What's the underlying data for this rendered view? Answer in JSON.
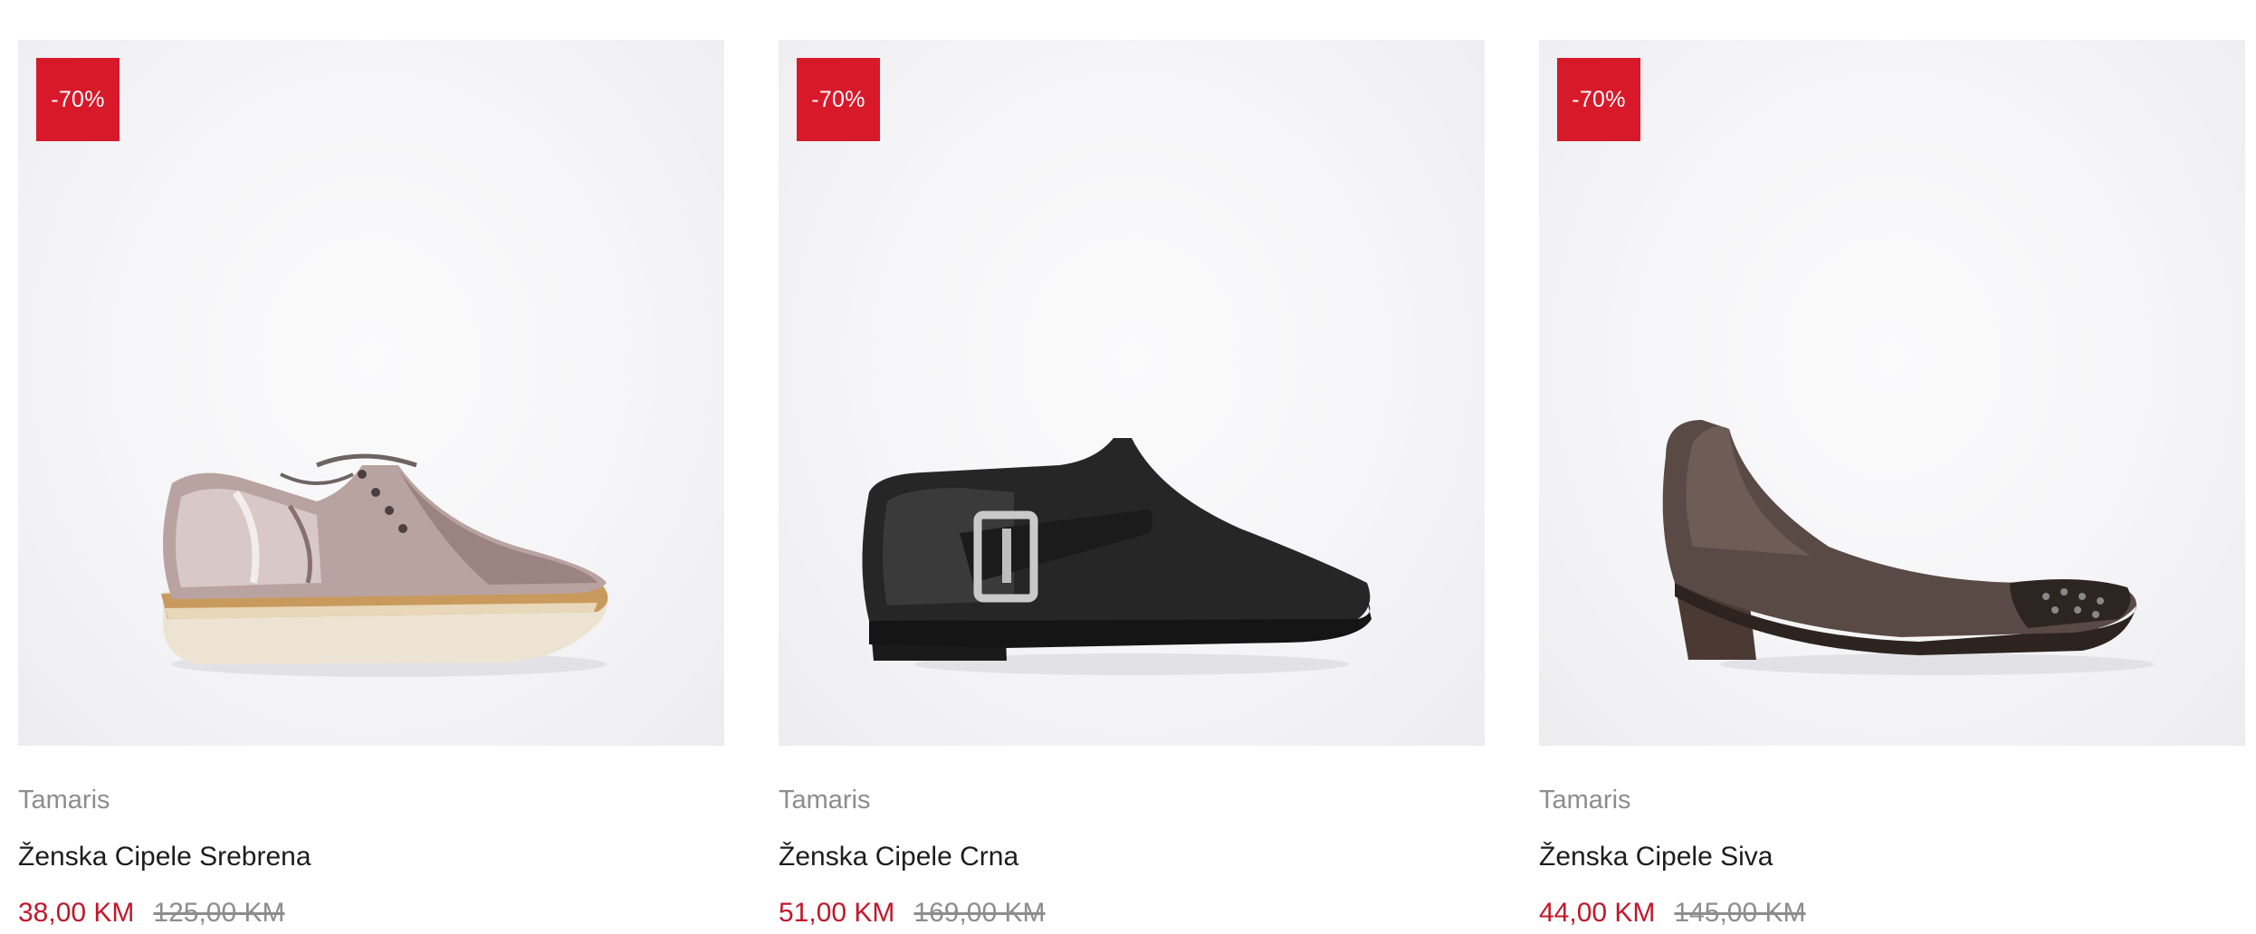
{
  "colors": {
    "badge_bg": "#d8192a",
    "sale_price": "#c0182b",
    "muted_text": "#8d8d8d",
    "image_bg": "#f4f4f6"
  },
  "products": [
    {
      "badge": "-70%",
      "brand": "Tamaris",
      "title": "Ženska Cipele Srebrena",
      "price": "38,00 KM",
      "old_price": "125,00 KM",
      "image": "metallic-lace-up-shoe"
    },
    {
      "badge": "-70%",
      "brand": "Tamaris",
      "title": "Ženska Cipele Crna",
      "price": "51,00 KM",
      "old_price": "169,00 KM",
      "image": "black-buckle-loafer"
    },
    {
      "badge": "-70%",
      "brand": "Tamaris",
      "title": "Ženska Cipele Siva",
      "price": "44,00 KM",
      "old_price": "145,00 KM",
      "image": "brown-heeled-pump"
    }
  ]
}
